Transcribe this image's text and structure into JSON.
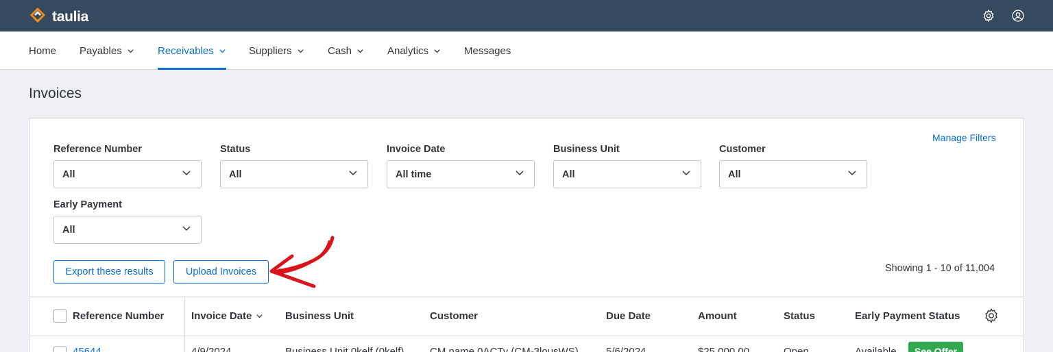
{
  "brand": {
    "name": "taulia",
    "accent": "#0a6ed1",
    "topbar_color": "#354a5f",
    "logo_color": "#f08a24"
  },
  "topbar": {
    "icons": [
      "settings-icon",
      "user-account-icon"
    ]
  },
  "nav": {
    "items": [
      {
        "label": "Home",
        "dropdown": false
      },
      {
        "label": "Payables",
        "dropdown": true
      },
      {
        "label": "Receivables",
        "dropdown": true,
        "active": true
      },
      {
        "label": "Suppliers",
        "dropdown": true
      },
      {
        "label": "Cash",
        "dropdown": true
      },
      {
        "label": "Analytics",
        "dropdown": true
      },
      {
        "label": "Messages",
        "dropdown": false
      }
    ]
  },
  "page": {
    "title": "Invoices"
  },
  "filters": {
    "manage_label": "Manage Filters",
    "items": [
      {
        "label": "Reference Number",
        "value": "All"
      },
      {
        "label": "Status",
        "value": "All"
      },
      {
        "label": "Invoice Date",
        "value": "All time"
      },
      {
        "label": "Business Unit",
        "value": "All"
      },
      {
        "label": "Customer",
        "value": "All"
      },
      {
        "label": "Early Payment",
        "value": "All"
      }
    ]
  },
  "actions": {
    "export_label": "Export these results",
    "upload_label": "Upload Invoices",
    "showing_text": "Showing 1 - 10 of 11,004",
    "annotation_color": "#d9141b"
  },
  "table": {
    "columns": [
      "Reference Number",
      "Invoice Date",
      "Business Unit",
      "Customer",
      "Due Date",
      "Amount",
      "Status",
      "Early Payment Status"
    ],
    "sort_icon": "chevron-down-icon",
    "rows": [
      {
        "reference": "45644",
        "invoice_date": "4/9/2024",
        "business_unit": "Business Unit 0kelf (0kelf)",
        "customer": "CM name 0ACTy (CM-3lousWS)",
        "due_date": "5/6/2024",
        "amount": "$25,000.00",
        "status": "Open",
        "early_payment_status": "Available",
        "offer_label": "See Offer",
        "offer_color": "#2fa84f"
      }
    ]
  }
}
